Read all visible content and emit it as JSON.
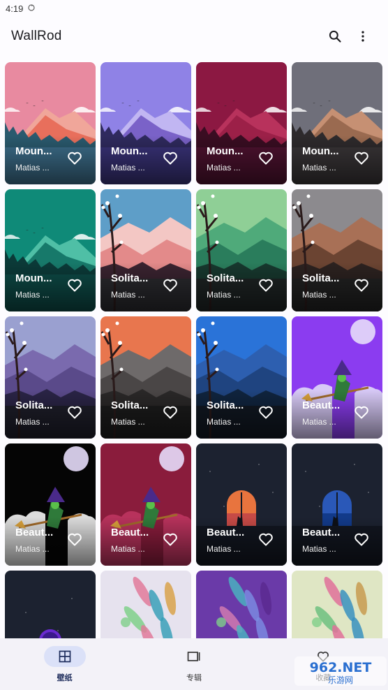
{
  "status_bar": {
    "time": "4:19",
    "sync_icon": "sync-icon"
  },
  "app_bar": {
    "title": "WallRod",
    "search_icon": "search-icon",
    "more_icon": "more-vert-icon"
  },
  "wallpapers": [
    {
      "title": "Moun...",
      "author": "Matias ...",
      "art": "mountain",
      "colors": {
        "sky": "#e88aa0",
        "far": "#f0a69a",
        "mid": "#e86f5c",
        "near": "#2a5a6e",
        "water": "#3d6f8c"
      }
    },
    {
      "title": "Moun...",
      "author": "Matias ...",
      "art": "mountain",
      "colors": {
        "sky": "#8f82e6",
        "far": "#c1b6f2",
        "mid": "#7a62c8",
        "near": "#2f2a5e",
        "water": "#3a337a"
      }
    },
    {
      "title": "Moun...",
      "author": "Matias ...",
      "art": "mountain",
      "colors": {
        "sky": "#8c1842",
        "far": "#b8325c",
        "mid": "#9c2048",
        "near": "#3a0d22",
        "water": "#4f1230"
      }
    },
    {
      "title": "Moun...",
      "author": "Matias ...",
      "art": "mountain",
      "colors": {
        "sky": "#6f6f7a",
        "far": "#c69073",
        "mid": "#9a6a50",
        "near": "#2e2a2c",
        "water": "#3a3638"
      }
    },
    {
      "title": "Moun...",
      "author": "Matias ...",
      "art": "mountain",
      "colors": {
        "sky": "#0f8a78",
        "far": "#4fbfa6",
        "mid": "#17796a",
        "near": "#0b3a38",
        "water": "#0d4a46"
      }
    },
    {
      "title": "Solita...",
      "author": "Matias ...",
      "art": "solitary",
      "colors": {
        "sky": "#5e9ec8",
        "far": "#f3c7c4",
        "mid": "#e38a8a",
        "near": "#3a2330",
        "water": "#2a2a2e"
      }
    },
    {
      "title": "Solita...",
      "author": "Matias ...",
      "art": "solitary",
      "colors": {
        "sky": "#8fcf96",
        "far": "#4faa7a",
        "mid": "#2a7d5c",
        "near": "#17382e",
        "water": "#1e2424"
      }
    },
    {
      "title": "Solita...",
      "author": "Matias ...",
      "art": "solitary",
      "colors": {
        "sky": "#8c8a8e",
        "far": "#a87056",
        "mid": "#6b4432",
        "near": "#2c2220",
        "water": "#222"
      }
    },
    {
      "title": "Solita...",
      "author": "Matias ...",
      "art": "solitary",
      "colors": {
        "sky": "#9aa0d0",
        "far": "#7a6aae",
        "mid": "#5a4a8a",
        "near": "#2a2446",
        "water": "#1e1e2a"
      }
    },
    {
      "title": "Solita...",
      "author": "Matias ...",
      "art": "solitary",
      "colors": {
        "sky": "#e8764e",
        "far": "#6e6a6a",
        "mid": "#4a4646",
        "near": "#2a2828",
        "water": "#1c1c1c"
      }
    },
    {
      "title": "Solita...",
      "author": "Matias ...",
      "art": "solitary",
      "colors": {
        "sky": "#2a73d8",
        "far": "#2d5fb0",
        "mid": "#1f4480",
        "near": "#10243e",
        "water": "#111822"
      }
    },
    {
      "title": "Beaut...",
      "author": "Matias ...",
      "art": "witch",
      "colors": {
        "sky": "#8b3cf0",
        "far": "#d7c9f6",
        "mid": "#6f2ad0",
        "near": "#5a20b0",
        "water": "#3a1a7a"
      }
    },
    {
      "title": "Beaut...",
      "author": "Matias ...",
      "art": "witch",
      "colors": {
        "sky": "#050505",
        "far": "#dcdcdc",
        "mid": "#111",
        "near": "#222",
        "water": "#0a0a0a"
      }
    },
    {
      "title": "Beaut...",
      "author": "Matias ...",
      "art": "witch",
      "colors": {
        "sky": "#8a1c3c",
        "far": "#b8325c",
        "mid": "#7a1634",
        "near": "#5a1028",
        "water": "#3a0a1a"
      }
    },
    {
      "title": "Beaut...",
      "author": "Matias ...",
      "art": "window",
      "colors": {
        "sky": "#1c2230",
        "far": "#e8743e",
        "mid": "#c64a46",
        "near": "#141a26",
        "water": "#121620"
      }
    },
    {
      "title": "Beaut...",
      "author": "Matias ...",
      "art": "window",
      "colors": {
        "sky": "#1c2230",
        "far": "#2a58b8",
        "mid": "#123a8a",
        "near": "#141a26",
        "water": "#121620"
      }
    },
    {
      "title": "",
      "author": "",
      "art": "planet",
      "colors": {
        "sky": "#1c2230",
        "far": "#6a2ad0",
        "mid": "#3a1a8a",
        "near": "#141a26",
        "water": "#121620"
      }
    },
    {
      "title": "",
      "author": "",
      "art": "leaves",
      "colors": {
        "sky": "#e6e2ee",
        "far": "#e07a9a",
        "mid": "#3aa0b8",
        "near": "#7fd08a",
        "water": "#d8a24a"
      }
    },
    {
      "title": "",
      "author": "",
      "art": "leaves",
      "colors": {
        "sky": "#6a3aa8",
        "far": "#4ab0c0",
        "mid": "#7a8ae0",
        "near": "#d07ab0",
        "water": "#5a2a90"
      }
    },
    {
      "title": "",
      "author": "",
      "art": "leaves",
      "colors": {
        "sky": "#dfe6c4",
        "far": "#e0709a",
        "mid": "#3a90c0",
        "near": "#6fc080",
        "water": "#c89a50"
      }
    }
  ],
  "bottom_nav": {
    "items": [
      {
        "label": "壁纸",
        "icon": "grid-icon",
        "active": true
      },
      {
        "label": "专辑",
        "icon": "album-icon",
        "active": false
      },
      {
        "label": "收藏",
        "icon": "heart-icon",
        "active": false
      }
    ]
  },
  "watermark": {
    "text": "962.NET",
    "subtext": "乐游网"
  }
}
